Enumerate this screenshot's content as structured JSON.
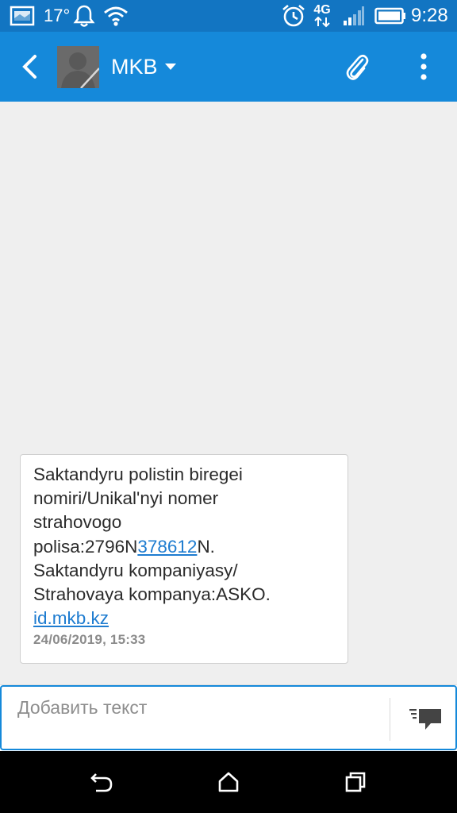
{
  "status_bar": {
    "temperature": "17°",
    "time": "9:28",
    "network_type": "4G",
    "icons": [
      "image-notification-icon",
      "bell-icon",
      "wifi-icon",
      "alarm-icon",
      "network-4g-icon",
      "signal-icon",
      "battery-icon"
    ]
  },
  "header": {
    "contact_name": "MKB",
    "icons": [
      "back-arrow-icon",
      "contact-avatar",
      "dropdown-caret-icon",
      "paperclip-icon",
      "more-vert-icon"
    ]
  },
  "message": {
    "line1": "Saktandyru polistin biregei",
    "line2": "nomiri/Unikal'nyi nomer",
    "line3": "strahovogo",
    "line4_prefix": "polisa:2796N",
    "line4_link": "378612",
    "line4_suffix": "N.",
    "line5": "Saktandyru kompaniyasy/",
    "line6": "Strahovaya kompanya:ASKO.",
    "link": "id.mkb.kz",
    "timestamp": "24/06/2019, 15:33"
  },
  "compose": {
    "placeholder": "Добавить текст",
    "value": ""
  },
  "nav": {
    "icons": [
      "back-nav-icon",
      "home-nav-icon",
      "recents-nav-icon"
    ]
  },
  "colors": {
    "status_bar": "#1275c2",
    "app_bar": "#1589da",
    "link": "#1e7cd0",
    "background": "#efefef"
  }
}
